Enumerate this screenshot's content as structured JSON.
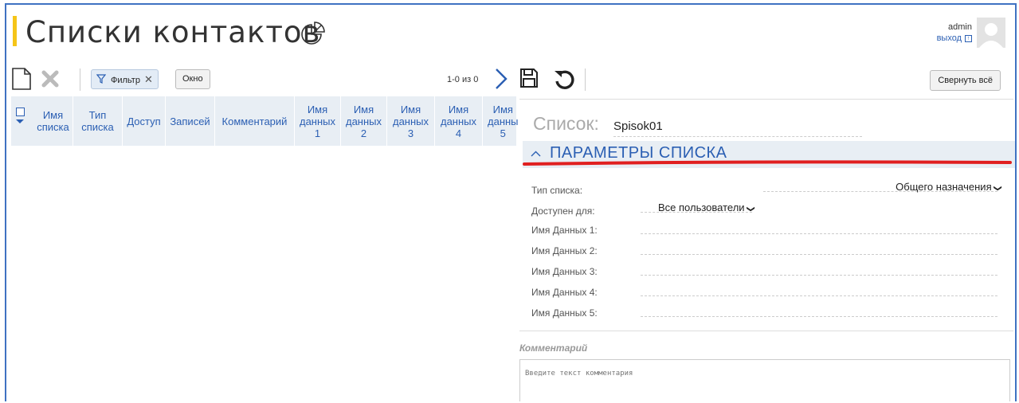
{
  "header": {
    "title": "Списки контактов",
    "user": "admin",
    "logout": "выход",
    "accent": "#f5c518"
  },
  "toolbar": {
    "filter_label": "Фильтр",
    "filter_clear": "✕",
    "okno_label": "Окно",
    "pager_text": "1-0 из 0"
  },
  "table": {
    "columns": [
      {
        "line1": "Имя",
        "line2": "списка",
        "line3": ""
      },
      {
        "line1": "Тип",
        "line2": "списка",
        "line3": ""
      },
      {
        "line1": "Доступ",
        "line2": "",
        "line3": ""
      },
      {
        "line1": "Записей",
        "line2": "",
        "line3": ""
      },
      {
        "line1": "Комментарий",
        "line2": "",
        "line3": ""
      },
      {
        "line1": "Имя",
        "line2": "данных",
        "line3": "1"
      },
      {
        "line1": "Имя",
        "line2": "данных",
        "line3": "2"
      },
      {
        "line1": "Имя",
        "line2": "данных",
        "line3": "3"
      },
      {
        "line1": "Имя",
        "line2": "данных",
        "line3": "4"
      },
      {
        "line1": "Имя",
        "line2": "данны",
        "line3": "5"
      }
    ]
  },
  "panel": {
    "collapse_all": "Свернуть всё",
    "list_label": "Список:",
    "list_value": "Spisok01",
    "section_title": "ПАРАМЕТРЫ СПИСКА",
    "fields": {
      "type_label": "Тип списка:",
      "type_value": "Общего назначения",
      "access_label": "Доступен для:",
      "access_value": "Все пользователи",
      "data1_label": "Имя Данных 1:",
      "data2_label": "Имя Данных 2:",
      "data3_label": "Имя Данных 3:",
      "data4_label": "Имя Данных 4:",
      "data5_label": "Имя Данных 5:"
    },
    "comment_label": "Комментарий",
    "comment_placeholder": "Введите текст комментария"
  },
  "colors": {
    "link_blue": "#2b5fb3",
    "header_bg": "#e8eef4",
    "annotation_red": "#e02020",
    "frame_blue": "#3f72c2"
  }
}
